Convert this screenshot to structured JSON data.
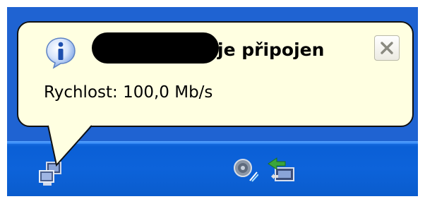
{
  "notification": {
    "title_suffix": "je připojen",
    "message": "Rychlost: 100,0 Mb/s",
    "icon": "info-icon",
    "close_icon": "close-icon"
  },
  "tray": {
    "icons": [
      "network-connection-icon",
      "volume-icon",
      "network-activity-icon"
    ]
  },
  "colors": {
    "taskbar": "#0d63da",
    "balloon_background": "#ffffe1",
    "info_icon": "#2e6fd8"
  }
}
